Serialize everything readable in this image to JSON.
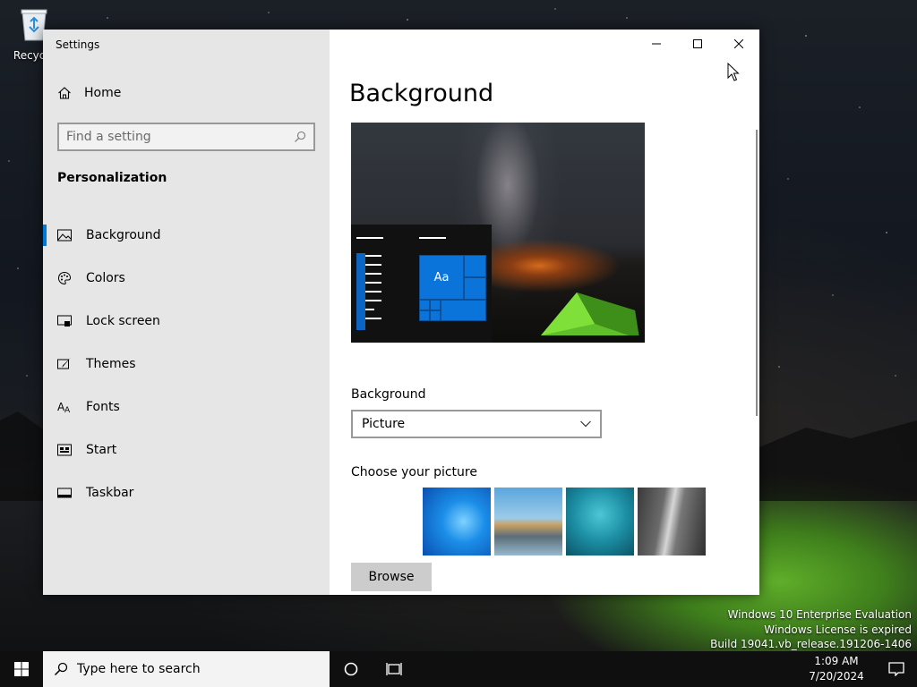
{
  "desktop": {
    "recycle_bin_label": "Recycle"
  },
  "window": {
    "title": "Settings",
    "sidebar": {
      "home_label": "Home",
      "search_placeholder": "Find a setting",
      "section_heading": "Personalization",
      "items": [
        {
          "label": "Background",
          "icon": "picture-icon",
          "active": true
        },
        {
          "label": "Colors",
          "icon": "palette-icon",
          "active": false
        },
        {
          "label": "Lock screen",
          "icon": "lock-screen-icon",
          "active": false
        },
        {
          "label": "Themes",
          "icon": "themes-icon",
          "active": false
        },
        {
          "label": "Fonts",
          "icon": "fonts-icon",
          "active": false
        },
        {
          "label": "Start",
          "icon": "start-icon",
          "active": false
        },
        {
          "label": "Taskbar",
          "icon": "taskbar-icon",
          "active": false
        }
      ]
    },
    "main": {
      "page_title": "Background",
      "preview_tile_text": "Aa",
      "background_label": "Background",
      "background_value": "Picture",
      "choose_picture_label": "Choose your picture",
      "browse_label": "Browse"
    },
    "accent_color": "#0078d7"
  },
  "watermark": {
    "line1": "Windows 10 Enterprise Evaluation",
    "line2": "Windows License is expired",
    "line3": "Build 19041.vb_release.191206-1406"
  },
  "taskbar": {
    "search_placeholder": "Type here to search",
    "time": "1:09 AM",
    "date": "7/20/2024"
  }
}
